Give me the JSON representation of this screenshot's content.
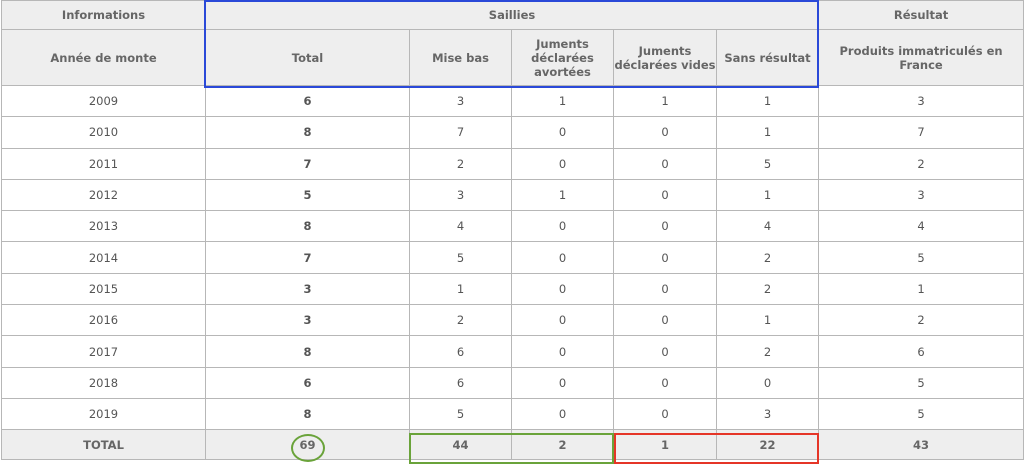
{
  "header": {
    "group_informations": "Informations",
    "group_saillies": "Saillies",
    "group_resultat": "Résultat",
    "col_annee": "Année de monte",
    "col_total": "Total",
    "col_mise_bas": "Mise bas",
    "col_avortees": "Juments déclarées avortées",
    "col_vides": "Juments déclarées vides",
    "col_sans_resultat": "Sans résultat",
    "col_produits": "Produits immatriculés en France"
  },
  "rows": [
    {
      "annee": "2009",
      "total": "6",
      "mise_bas": "3",
      "avortees": "1",
      "vides": "1",
      "sans_resultat": "1",
      "produits": "3"
    },
    {
      "annee": "2010",
      "total": "8",
      "mise_bas": "7",
      "avortees": "0",
      "vides": "0",
      "sans_resultat": "1",
      "produits": "7"
    },
    {
      "annee": "2011",
      "total": "7",
      "mise_bas": "2",
      "avortees": "0",
      "vides": "0",
      "sans_resultat": "5",
      "produits": "2"
    },
    {
      "annee": "2012",
      "total": "5",
      "mise_bas": "3",
      "avortees": "1",
      "vides": "0",
      "sans_resultat": "1",
      "produits": "3"
    },
    {
      "annee": "2013",
      "total": "8",
      "mise_bas": "4",
      "avortees": "0",
      "vides": "0",
      "sans_resultat": "4",
      "produits": "4"
    },
    {
      "annee": "2014",
      "total": "7",
      "mise_bas": "5",
      "avortees": "0",
      "vides": "0",
      "sans_resultat": "2",
      "produits": "5"
    },
    {
      "annee": "2015",
      "total": "3",
      "mise_bas": "1",
      "avortees": "0",
      "vides": "0",
      "sans_resultat": "2",
      "produits": "1"
    },
    {
      "annee": "2016",
      "total": "3",
      "mise_bas": "2",
      "avortees": "0",
      "vides": "0",
      "sans_resultat": "1",
      "produits": "2"
    },
    {
      "annee": "2017",
      "total": "8",
      "mise_bas": "6",
      "avortees": "0",
      "vides": "0",
      "sans_resultat": "2",
      "produits": "6"
    },
    {
      "annee": "2018",
      "total": "6",
      "mise_bas": "6",
      "avortees": "0",
      "vides": "0",
      "sans_resultat": "0",
      "produits": "5"
    },
    {
      "annee": "2019",
      "total": "8",
      "mise_bas": "5",
      "avortees": "0",
      "vides": "0",
      "sans_resultat": "3",
      "produits": "5"
    }
  ],
  "totals": {
    "label": "TOTAL",
    "total": "69",
    "mise_bas": "44",
    "avortees": "2",
    "vides": "1",
    "sans_resultat": "22",
    "produits": "43"
  },
  "highlight_colors": {
    "saillies_box": "#2a49d8",
    "green_marks": "#6aa33a",
    "red_box": "#e53527"
  }
}
